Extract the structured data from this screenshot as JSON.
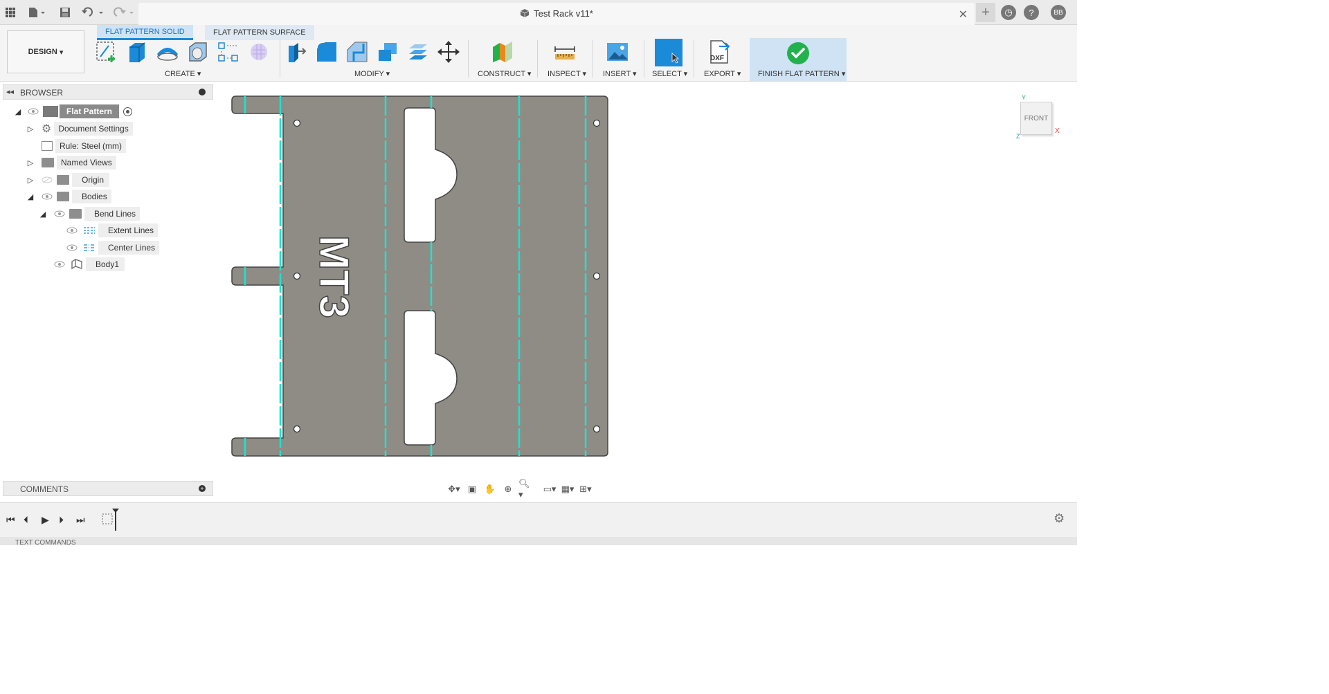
{
  "window": {
    "doc_title": "Test Rack v11*",
    "user_initials": "BB",
    "help_glyph": "?"
  },
  "ribbon": {
    "workspace": "DESIGN",
    "tabs": [
      {
        "label": "FLAT PATTERN SOLID",
        "active": true
      },
      {
        "label": "FLAT PATTERN SURFACE",
        "active": false
      }
    ],
    "groups": {
      "create": "CREATE",
      "modify": "MODIFY",
      "construct": "CONSTRUCT",
      "inspect": "INSPECT",
      "insert": "INSERT",
      "select": "SELECT",
      "export": "EXPORT",
      "finish": "FINISH FLAT PATTERN"
    },
    "export_icon_text": "DXF"
  },
  "browser": {
    "title": "BROWSER",
    "items": [
      {
        "label": "Flat Pattern",
        "level": 0
      },
      {
        "label": "Document Settings",
        "level": 1
      },
      {
        "label": "Rule: Steel (mm)",
        "level": 1
      },
      {
        "label": "Named Views",
        "level": 1
      },
      {
        "label": "Origin",
        "level": 1
      },
      {
        "label": "Bodies",
        "level": 1
      },
      {
        "label": "Bend Lines",
        "level": 2
      },
      {
        "label": "Extent Lines",
        "level": 3
      },
      {
        "label": "Center Lines",
        "level": 3
      },
      {
        "label": "Body1",
        "level": 2
      }
    ]
  },
  "comments": {
    "title": "COMMENTS"
  },
  "viewcube": {
    "face": "FRONT",
    "axis_x": "X",
    "axis_y": "Y",
    "axis_z": "Z"
  },
  "part": {
    "engraving": "MT3"
  },
  "text_commands": {
    "title": "TEXT COMMANDS"
  },
  "colors": {
    "sheet": "#8f8b85",
    "bend_line": "#19e5d0",
    "accent": "#1b8ad8",
    "finish_green": "#22b24c"
  }
}
